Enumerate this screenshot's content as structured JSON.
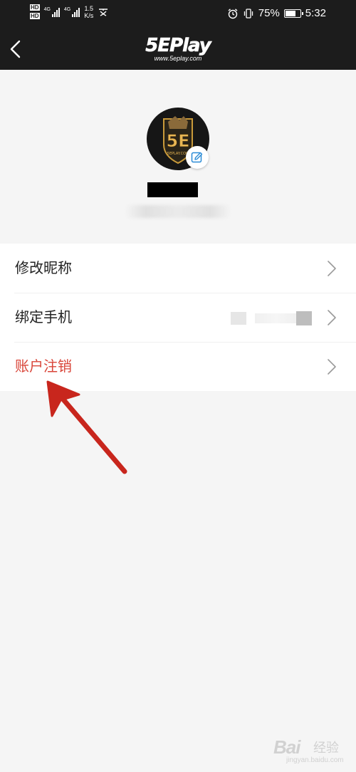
{
  "status_bar": {
    "hd_labels": [
      "HD",
      "HD"
    ],
    "network": "4G",
    "speed_value": "1.5",
    "speed_unit": "K/s",
    "battery_percent": "75%",
    "battery_level": 0.75,
    "time": "5:32"
  },
  "nav": {
    "logo_text": "5EPlay",
    "logo_url": "www.5eplay.com"
  },
  "profile": {
    "avatar_text": "5E",
    "avatar_subtext": "5EPLAY.COM"
  },
  "menu": {
    "items": [
      {
        "label": "修改昵称"
      },
      {
        "label": "绑定手机"
      },
      {
        "label": "账户注销"
      }
    ]
  },
  "watermark": {
    "brand": "Bai",
    "sub": "经验",
    "url": "jingyan.baidu.com"
  },
  "colors": {
    "header_bg": "#1c1c1c",
    "page_bg": "#f5f5f5",
    "danger": "#d9463a",
    "accent": "#2a8bd6",
    "annotation_arrow": "#c8261d"
  }
}
